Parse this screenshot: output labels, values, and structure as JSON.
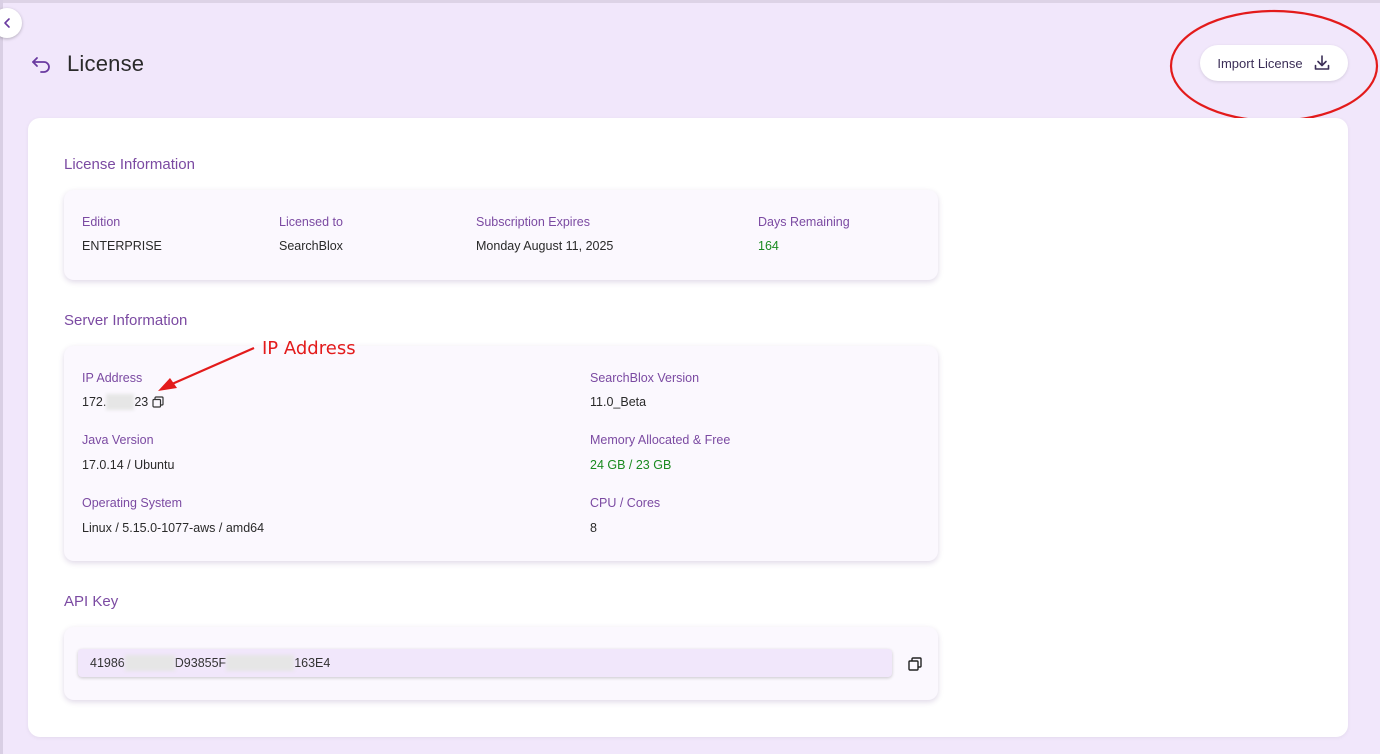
{
  "page": {
    "title": "License"
  },
  "toolbar": {
    "import_label": "Import License"
  },
  "license_info": {
    "section_title": "License Information",
    "fields": [
      {
        "label": "Edition",
        "value": "ENTERPRISE"
      },
      {
        "label": "Licensed to",
        "value": "SearchBlox"
      },
      {
        "label": "Subscription Expires",
        "value": "Monday August 11, 2025"
      },
      {
        "label": "Days Remaining",
        "value": "164"
      }
    ]
  },
  "server_info": {
    "section_title": "Server Information",
    "ip_address": {
      "label": "IP Address",
      "value_start": "172.",
      "value_end": "23"
    },
    "searchblox_version": {
      "label": "SearchBlox Version",
      "value": "11.0_Beta"
    },
    "java_version": {
      "label": "Java Version",
      "value": "17.0.14 / Ubuntu"
    },
    "memory": {
      "label": "Memory Allocated & Free",
      "value": "24 GB / 23 GB"
    },
    "os": {
      "label": "Operating System",
      "value": "Linux / 5.15.0-1077-aws / amd64"
    },
    "cpu": {
      "label": "CPU / Cores",
      "value": "8"
    }
  },
  "api_key": {
    "section_title": "API Key",
    "part1": "41986",
    "part2": "D93855F",
    "part3": "163E4"
  },
  "annotation": {
    "text": "IP Address"
  },
  "colors": {
    "accent": "#7b4aa2",
    "background": "#f1e7fb",
    "positive": "#1a8a20",
    "annotation": "#e31b1b"
  },
  "icons": [
    "chevron-left-icon",
    "back-arrow-icon",
    "download-icon",
    "copy-icon"
  ]
}
